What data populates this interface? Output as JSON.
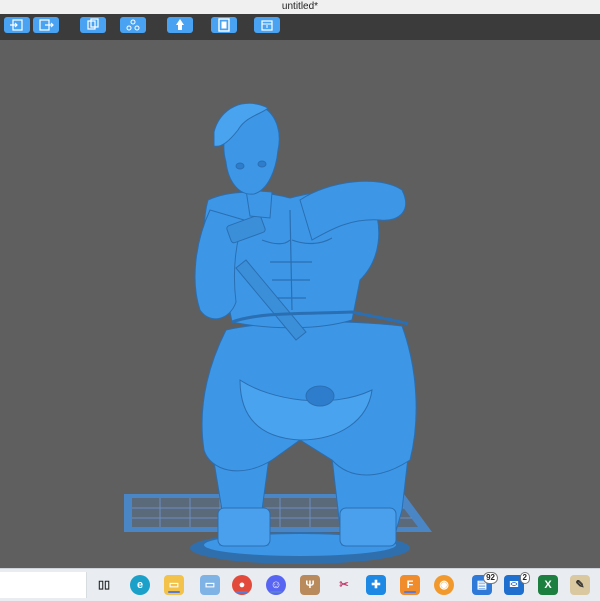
{
  "window": {
    "title": "untitled*"
  },
  "toolbar": {
    "buttons": [
      {
        "icon": "import-icon"
      },
      {
        "icon": "export-icon"
      },
      {
        "icon": "copy-icon"
      },
      {
        "icon": "network-icon"
      },
      {
        "icon": "supports-icon"
      },
      {
        "icon": "frame-icon"
      },
      {
        "icon": "slice-icon"
      }
    ]
  },
  "viewport": {
    "model_color": "#3d97e6",
    "bed_color": "#4b86c6",
    "background": "#5f5f5f"
  },
  "taskbar": {
    "icons": [
      {
        "name": "task-view-icon"
      },
      {
        "name": "edge-icon"
      },
      {
        "name": "file-explorer-icon"
      },
      {
        "name": "laptop-icon"
      },
      {
        "name": "chrome-icon"
      },
      {
        "name": "discord-icon"
      },
      {
        "name": "deer-app-icon"
      },
      {
        "name": "scissors-app-icon"
      },
      {
        "name": "cross-app-icon"
      },
      {
        "name": "fusion-app-icon"
      },
      {
        "name": "blender-icon"
      },
      {
        "name": "files-icon",
        "badge": "92"
      },
      {
        "name": "mail-icon",
        "badge": "2"
      },
      {
        "name": "excel-icon"
      },
      {
        "name": "paint-icon"
      }
    ]
  }
}
